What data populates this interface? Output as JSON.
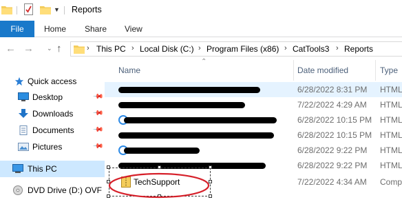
{
  "window": {
    "title": "Reports"
  },
  "ribbon": {
    "file": "File",
    "tabs": [
      "Home",
      "Share",
      "View"
    ]
  },
  "address": {
    "crumbs": [
      "This PC",
      "Local Disk (C:)",
      "Program Files (x86)",
      "CatTools3",
      "Reports"
    ]
  },
  "sidebar": {
    "quick_access": "Quick access",
    "items": [
      {
        "label": "Desktop",
        "icon": "desktop-icon",
        "pinned": true
      },
      {
        "label": "Downloads",
        "icon": "downloads-icon",
        "pinned": true
      },
      {
        "label": "Documents",
        "icon": "documents-icon",
        "pinned": true
      },
      {
        "label": "Pictures",
        "icon": "pictures-icon",
        "pinned": true
      }
    ],
    "this_pc": "This PC",
    "dvd": "DVD Drive (D:) OVF El"
  },
  "columns": {
    "name": "Name",
    "date": "Date modified",
    "type": "Type"
  },
  "files": [
    {
      "name": "",
      "redacted": true,
      "date": "6/28/2022 8:31 PM",
      "type": "HTML"
    },
    {
      "name": "",
      "redacted": true,
      "date": "7/22/2022 4:29 AM",
      "type": "HTML"
    },
    {
      "name": "",
      "redacted": true,
      "date": "6/28/2022 10:15 PM",
      "type": "HTML"
    },
    {
      "name": "",
      "redacted": true,
      "date": "6/28/2022 10:15 PM",
      "type": "HTML"
    },
    {
      "name": "",
      "redacted": true,
      "date": "6/28/2022 9:22 PM",
      "type": "HTML"
    },
    {
      "name": "",
      "redacted": true,
      "date": "6/28/2022 9:22 PM",
      "type": "HTML"
    },
    {
      "name": "TechSupport",
      "redacted": false,
      "date": "7/22/2022 4:34 AM",
      "type": "Comp"
    }
  ],
  "colors": {
    "accent": "#1979ca",
    "selection": "#cde8ff",
    "hover": "#e5f3ff",
    "annotation": "#d6202a"
  }
}
